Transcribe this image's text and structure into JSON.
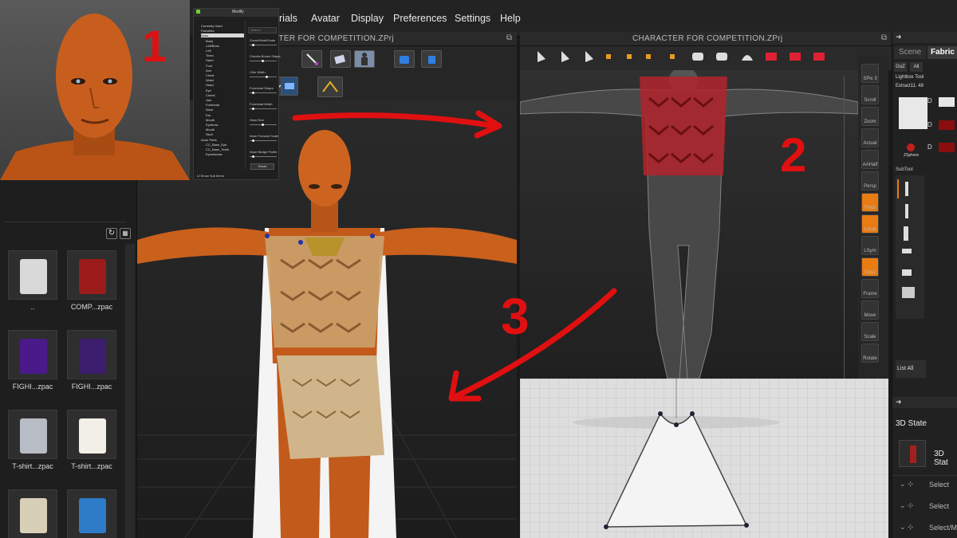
{
  "menu": [
    "rials",
    "Avatar",
    "Display",
    "Preferences",
    "Settings",
    "Help"
  ],
  "viewport_left_title": "CTER FOR COMPETITION.ZPrj",
  "viewport_right_title": "CHARACTER FOR COMPETITION.ZPrj",
  "library": {
    "items": [
      {
        "label": "..",
        "color": "#d9d9d9"
      },
      {
        "label": "COMP...zpac",
        "color": "#9c1b1b"
      },
      {
        "label": "FIGHI...zpac",
        "color": "#4b1a8a"
      },
      {
        "label": "FIGHI...zpac",
        "color": "#3d1d6e"
      },
      {
        "label": "T-shirt...zpac",
        "color": "#b8bcc4"
      },
      {
        "label": "T-shirt...zpac",
        "color": "#f2efe6"
      },
      {
        "label": "",
        "color": "#d8cfb8"
      },
      {
        "label": "",
        "color": "#2e7cc7"
      }
    ]
  },
  "annotations": {
    "one": "1",
    "two": "2",
    "three": "3"
  },
  "modify_panel": {
    "title": "Modify",
    "search": "Search",
    "tree": [
      "Currently Used",
      "Favorites",
      "Actor",
      "Body",
      "Left/Brow",
      "Left",
      "Torso",
      "Hand",
      "Foot",
      "Arm",
      "Chest",
      "Waist",
      "Head",
      "Eye",
      "Cheek",
      "Jaw",
      "Forehead",
      "Nose",
      "Ear",
      "Mouth",
      "Eyebrow",
      "Mouth",
      "Skull",
      "Actor Parts",
      "CC_Base_Eye",
      "CC_Base_Teeth",
      "Eyeshadow"
    ],
    "sliders": [
      {
        "label": "Zoom/ModelScale",
        "value": 0.1
      },
      {
        "label": "Cheeks Bones Shape",
        "value": 0.45
      },
      {
        "label": "Chin Width",
        "value": 0.6
      },
      {
        "label": "Forehead Shape",
        "value": 0.1
      },
      {
        "label": "Forehead Width",
        "value": 0.1
      },
      {
        "label": "Head Size",
        "value": 0.45
      },
      {
        "label": "Nose Forward Scale",
        "value": 0.1
      },
      {
        "label": "Nose Bridge Profile",
        "value": 0.1
      }
    ],
    "reset": "Reset",
    "show_sub": "Show Sub Items"
  },
  "right_panel": {
    "tabs": [
      "Scene",
      "Fabric"
    ],
    "goz": "GoZ",
    "all": "All",
    "lightbox": "Lightbox Tool",
    "extract": "Extract11. 48",
    "zsphere": "ZSphere",
    "subtool": "SubTool",
    "list_all": "List All",
    "state_title": "3D State",
    "state_label": "3D Stat",
    "selects": [
      "Select",
      "Select",
      "Select/M"
    ],
    "sidebar": [
      "SPix 3",
      "Scroll",
      "Zoom",
      "Actual",
      "AAHalf",
      "Persp",
      "Floor",
      "Local",
      "LSym",
      "Gxyz",
      "Frame",
      "Move",
      "Scale",
      "Rotate"
    ]
  },
  "colors": {
    "red": "#e01010",
    "accent": "#e87b12",
    "skin": "#c9601c"
  }
}
